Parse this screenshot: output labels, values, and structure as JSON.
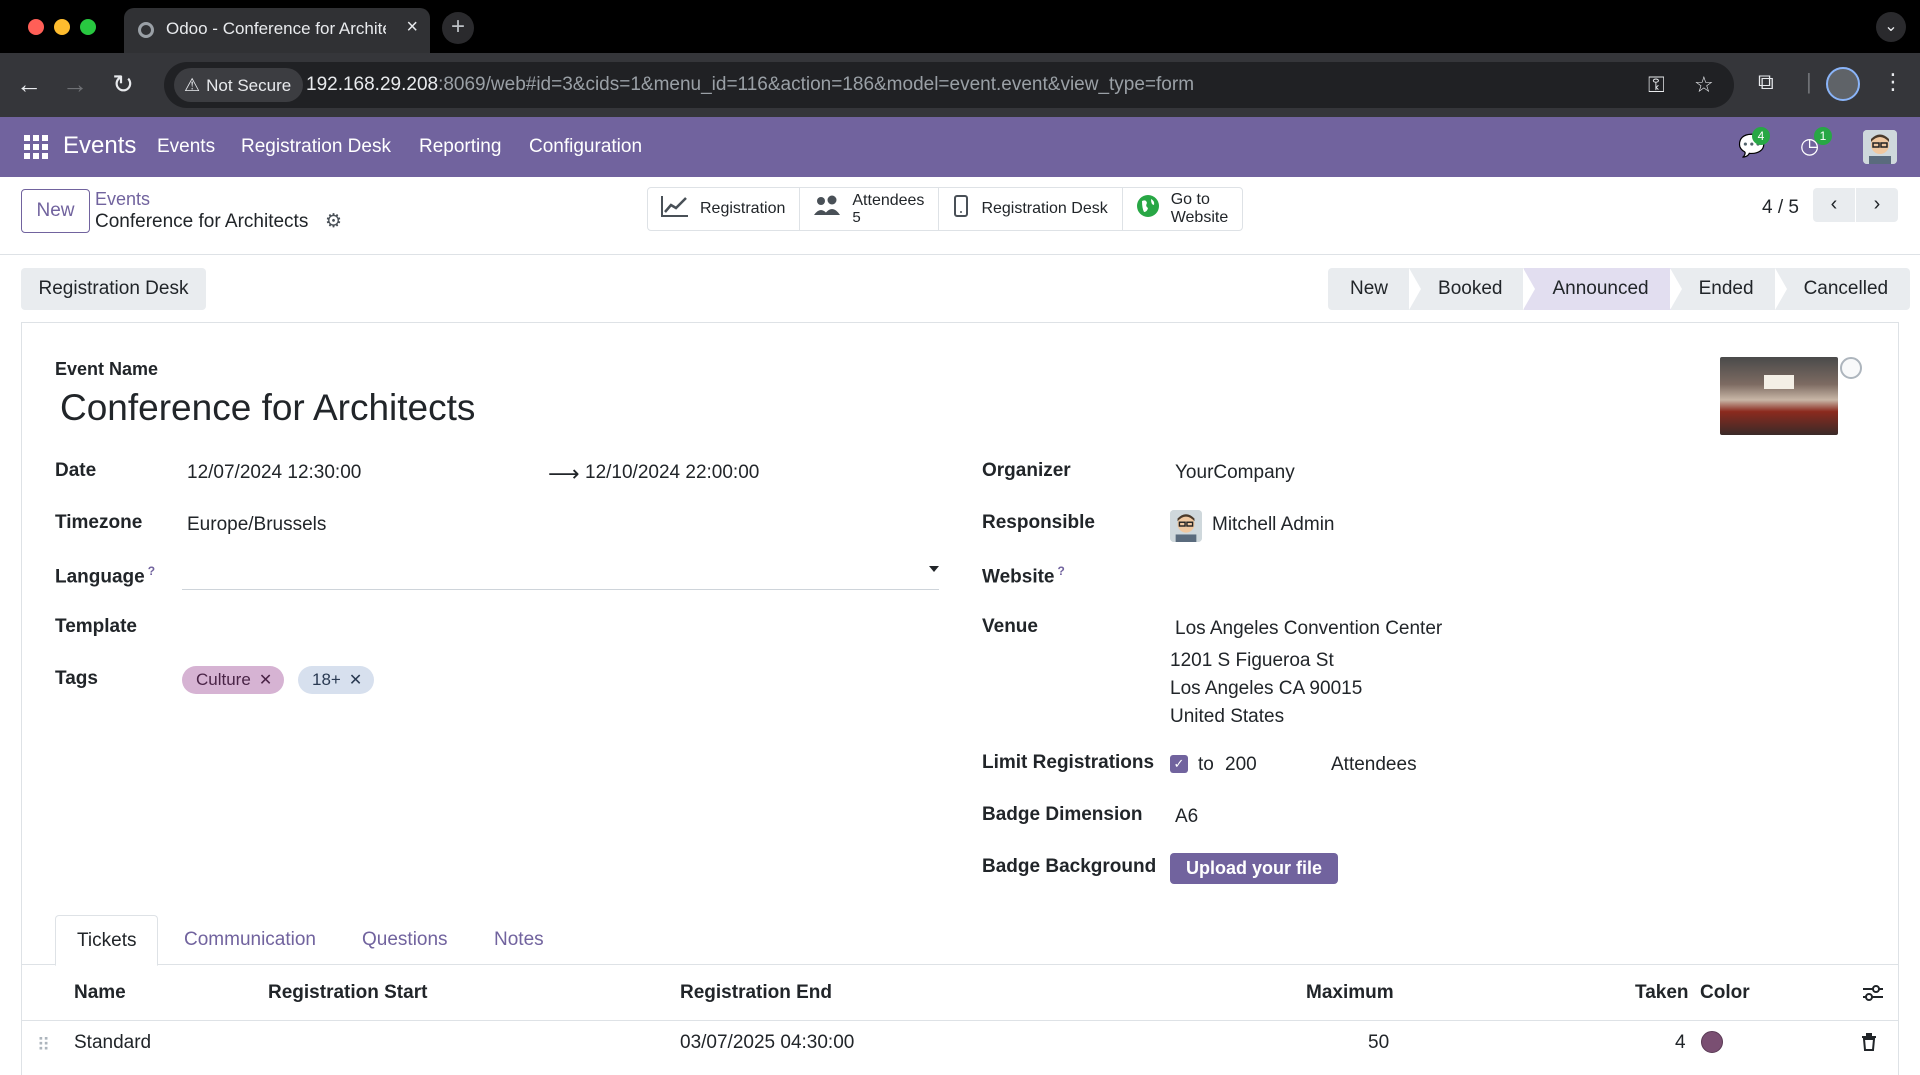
{
  "browser": {
    "tab_title": "Odoo - Conference for Architects",
    "tab_close": "×",
    "new_tab": "+",
    "security_label": "Not Secure",
    "url_host": "192.168.29.208",
    "url_rest": ":8069/web#id=3&cids=1&menu_id=116&action=186&model=event.event&view_type=form"
  },
  "navbar": {
    "brand": "Events",
    "menu": [
      "Events",
      "Registration Desk",
      "Reporting",
      "Configuration"
    ],
    "messages_count": "4",
    "activities_count": "1"
  },
  "control_panel": {
    "new_button": "New",
    "breadcrumb_parent": "Events",
    "breadcrumb_current": "Conference for Architects",
    "smart_buttons": {
      "registration": "Registration",
      "attendees_label": "Attendees",
      "attendees_count": "5",
      "registration_desk": "Registration Desk",
      "go_to": "Go to",
      "website": "Website"
    },
    "pager": "4 / 5"
  },
  "statusbar": {
    "action_button": "Registration Desk",
    "stages": [
      "New",
      "Booked",
      "Announced",
      "Ended",
      "Cancelled"
    ],
    "active_stage": "Announced"
  },
  "form": {
    "event_name_label": "Event Name",
    "event_name": "Conference for Architects",
    "date_label": "Date",
    "date_start": "12/07/2024 12:30:00",
    "date_end": "12/10/2024 22:00:00",
    "timezone_label": "Timezone",
    "timezone": "Europe/Brussels",
    "language_label": "Language",
    "language_help": "?",
    "template_label": "Template",
    "tags_label": "Tags",
    "tags": [
      "Culture",
      "18+"
    ],
    "organizer_label": "Organizer",
    "organizer": "YourCompany",
    "responsible_label": "Responsible",
    "responsible": "Mitchell Admin",
    "website_label": "Website",
    "website_help": "?",
    "venue_label": "Venue",
    "venue_name": "Los Angeles Convention Center",
    "venue_street": "1201 S Figueroa St",
    "venue_city": "Los Angeles CA 90015",
    "venue_country": "United States",
    "limit_label": "Limit Registrations",
    "limit_to": "to",
    "limit_value": "200",
    "limit_unit": "Attendees",
    "badge_dimension_label": "Badge Dimension",
    "badge_dimension": "A6",
    "badge_background_label": "Badge Background",
    "upload_button": "Upload your file"
  },
  "notebook": {
    "tabs": [
      "Tickets",
      "Communication",
      "Questions",
      "Notes"
    ],
    "active_tab": "Tickets",
    "columns": {
      "name": "Name",
      "reg_start": "Registration Start",
      "reg_end": "Registration End",
      "maximum": "Maximum",
      "taken": "Taken",
      "color": "Color"
    },
    "rows": [
      {
        "name": "Standard",
        "reg_start": "",
        "reg_end": "03/07/2025 04:30:00",
        "maximum": "50",
        "taken": "4",
        "color": "#7a4f72"
      }
    ]
  }
}
